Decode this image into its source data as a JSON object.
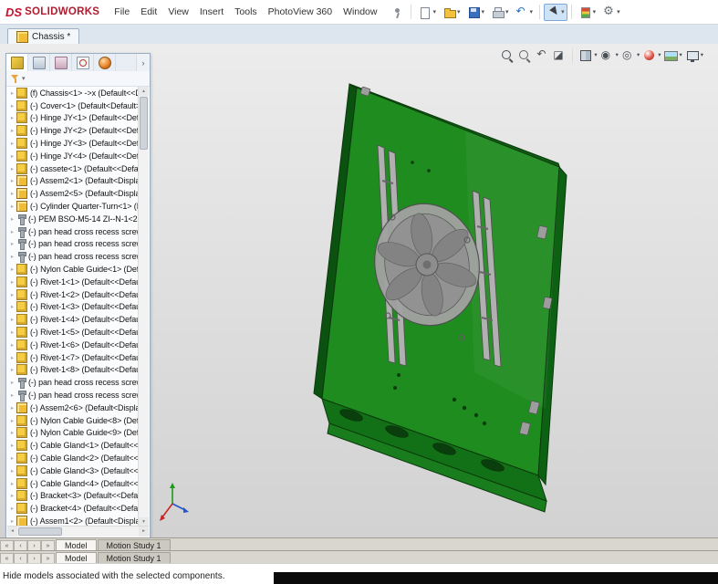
{
  "app": {
    "logo_mark": "DS",
    "logo_text": "SOLIDWORKS",
    "menus": [
      "File",
      "Edit",
      "View",
      "Insert",
      "Tools",
      "PhotoView 360",
      "Window"
    ]
  },
  "toolbar": {
    "items": [
      {
        "name": "pin-menu-icon",
        "cls": "ic-pin"
      },
      {
        "sep": true
      },
      {
        "name": "new-document-icon",
        "cls": "ic-new",
        "caret": true
      },
      {
        "name": "open-document-icon",
        "cls": "ic-open",
        "caret": true
      },
      {
        "name": "save-icon",
        "cls": "ic-save",
        "caret": true
      },
      {
        "name": "print-icon",
        "cls": "ic-print",
        "caret": true
      },
      {
        "name": "undo-icon",
        "cls": "ic-undo",
        "caret": true
      },
      {
        "sep": true
      },
      {
        "name": "select-arrow-icon",
        "cls": "ic-select",
        "caret": true,
        "hl": true
      },
      {
        "sep": true
      },
      {
        "name": "rebuild-icon",
        "cls": "ic-rebuild",
        "caret": true
      },
      {
        "name": "options-gear-icon",
        "cls": "ic-gear",
        "caret": true
      }
    ]
  },
  "document_tab": {
    "label": "Chassis *"
  },
  "view_toolbar": {
    "items": [
      {
        "name": "zoom-to-fit-icon",
        "cls": "vi-zoom"
      },
      {
        "name": "zoom-to-area-icon",
        "cls": "vi-zoom2"
      },
      {
        "name": "previous-view-icon",
        "cls": "vi-prev"
      },
      {
        "name": "section-view-icon",
        "cls": "vi-section"
      },
      {
        "sep": true
      },
      {
        "name": "view-orientation-icon",
        "cls": "vi-orient",
        "caret": true
      },
      {
        "name": "display-style-icon",
        "cls": "vi-display",
        "caret": true
      },
      {
        "name": "hide-show-items-icon",
        "cls": "vi-hide",
        "caret": true
      },
      {
        "name": "edit-appearance-icon",
        "cls": "vi-appearance",
        "caret": true
      },
      {
        "name": "apply-scene-icon",
        "cls": "vi-scene",
        "caret": true
      },
      {
        "name": "view-settings-icon",
        "cls": "vi-monitor",
        "caret": true
      }
    ]
  },
  "tree": {
    "tabs": [
      {
        "name": "featuremanager-tab",
        "cls": "tt-feat",
        "active": true
      },
      {
        "name": "propertymanager-tab",
        "cls": "tt-prop"
      },
      {
        "name": "configurationmanager-tab",
        "cls": "tt-conf"
      },
      {
        "name": "dimxpertmanager-tab",
        "cls": "tt-dim"
      },
      {
        "name": "displaymanager-tab",
        "cls": "tt-disp"
      }
    ],
    "items": [
      {
        "label": "(f) Chassis<1> ->x (Default<<De",
        "icon": "part"
      },
      {
        "label": "(-) Cover<1> (Default<Default>",
        "icon": "part"
      },
      {
        "label": "(-) Hinge JY<1> (Default<<Defa",
        "icon": "part"
      },
      {
        "label": "(-) Hinge JY<2> (Default<<Defa",
        "icon": "part"
      },
      {
        "label": "(-) Hinge JY<3> (Default<<Defa",
        "icon": "part"
      },
      {
        "label": "(-) Hinge JY<4> (Default<<Defa",
        "icon": "part"
      },
      {
        "label": "(-) cassete<1> (Default<<Default",
        "icon": "part"
      },
      {
        "label": "(-) Assem2<1> (Default<Display",
        "icon": "asm"
      },
      {
        "label": "(-) Assem2<5> (Default<Display",
        "icon": "asm"
      },
      {
        "label": "(-) Cylinder Quarter-Turn<1> (De",
        "icon": "asm"
      },
      {
        "label": "(-) PEM BSO-M5-14 ZI--N-1<2>",
        "icon": "screw"
      },
      {
        "label": "(-) pan head cross recess screw_is",
        "icon": "screw"
      },
      {
        "label": "(-) pan head cross recess screw_is",
        "icon": "screw"
      },
      {
        "label": "(-) pan head cross recess screw_is",
        "icon": "screw"
      },
      {
        "label": "(-) Nylon Cable Guide<1> (Defau",
        "icon": "part"
      },
      {
        "label": "(-) Rivet-1<1> (Default<<Default",
        "icon": "part"
      },
      {
        "label": "(-) Rivet-1<2> (Default<<Default",
        "icon": "part"
      },
      {
        "label": "(-) Rivet-1<3> (Default<<Default",
        "icon": "part"
      },
      {
        "label": "(-) Rivet-1<4> (Default<<Default",
        "icon": "part"
      },
      {
        "label": "(-) Rivet-1<5> (Default<<Default",
        "icon": "part"
      },
      {
        "label": "(-) Rivet-1<6> (Default<<Default",
        "icon": "part"
      },
      {
        "label": "(-) Rivet-1<7> (Default<<Default",
        "icon": "part"
      },
      {
        "label": "(-) Rivet-1<8> (Default<<Default",
        "icon": "part"
      },
      {
        "label": "(-) pan head cross recess screw_is",
        "icon": "screw"
      },
      {
        "label": "(-) pan head cross recess screw_is",
        "icon": "screw"
      },
      {
        "label": "(-) Assem2<6> (Default<Display",
        "icon": "asm"
      },
      {
        "label": "(-) Nylon Cable Guide<8> (Defau",
        "icon": "part"
      },
      {
        "label": "(-) Nylon Cable Guide<9> (Defau",
        "icon": "part"
      },
      {
        "label": "(-) Cable Gland<1> (Default<<D",
        "icon": "part"
      },
      {
        "label": "(-) Cable Gland<2> (Default<<D",
        "icon": "part"
      },
      {
        "label": "(-) Cable Gland<3> (Default<<D",
        "icon": "part"
      },
      {
        "label": "(-) Cable Gland<4> (Default<<D",
        "icon": "part"
      },
      {
        "label": "(-) Bracket<3> (Default<<Default",
        "icon": "part"
      },
      {
        "label": "(-) Bracket<4> (Default<<Default",
        "icon": "part"
      },
      {
        "label": "(-) Assem1<2> (Default<Display",
        "icon": "asm"
      }
    ]
  },
  "window_tabs": {
    "nav": [
      {
        "name": "first-tab-button",
        "glyph": "«"
      },
      {
        "name": "previous-tab-button",
        "glyph": "‹"
      },
      {
        "name": "next-tab-button",
        "glyph": "›"
      },
      {
        "name": "last-tab-button",
        "glyph": "»"
      }
    ],
    "tabs": [
      {
        "label": "Model",
        "active": true
      },
      {
        "label": "Motion Study 1"
      }
    ]
  },
  "status": {
    "text": "Hide models associated with the selected components."
  },
  "glyphs": {
    "caret": "▾",
    "expander": "▸",
    "chevron": "›",
    "scroll_up": "▴",
    "scroll_down": "▾",
    "scroll_left": "◂",
    "scroll_right": "▸"
  },
  "colors": {
    "brand_red": "#b01c2e",
    "select_blue": "#cfe3f7",
    "green_main": "#1f8c1f",
    "green_dark": "#0d6112",
    "green_deep": "#0b5210",
    "green_top": "#115c13",
    "green_flange": "#127016",
    "green_lip": "#1a7d1d",
    "hole_green": "#0a3f0d",
    "viewport_top": "#ececec",
    "viewport_bottom": "#d2d2d2"
  }
}
